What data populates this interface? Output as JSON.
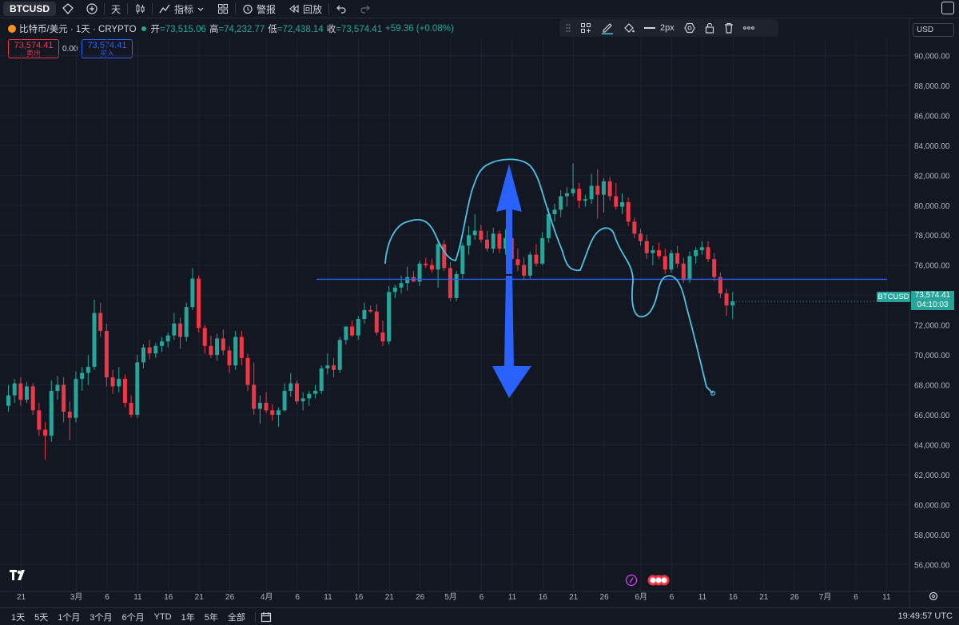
{
  "toolbar": {
    "symbol": "BTCUSD",
    "interval": "天",
    "indicators": "指标",
    "alerts": "警报",
    "replay": "回放"
  },
  "legend": {
    "title": "比特币/美元 · 1天 · CRYPTO",
    "open_label": "开",
    "open": "=73,515.06",
    "high_label": "高",
    "high": "=74,232.77",
    "low_label": "低",
    "low": "=72,438.14",
    "close_label": "收",
    "close": "=73,574.41",
    "change": "+59.36 (+0.08%)"
  },
  "trade": {
    "sell_price": "73,574.41",
    "sell_label": "卖出",
    "spread": "0.00",
    "buy_price": "73,574.41",
    "buy_label": "买入"
  },
  "drawing_toolbar": {
    "width_label": "2px"
  },
  "currency": "USD",
  "price_label": {
    "symbol": "BTCUSD",
    "price": "73,574.41",
    "countdown": "04:10:03"
  },
  "bottom": {
    "ranges": [
      "1天",
      "5天",
      "1个月",
      "3个月",
      "6个月",
      "YTD",
      "1年",
      "5年",
      "全部"
    ],
    "clock": "19:49:57 UTC"
  },
  "colors": {
    "up": "#26a69a",
    "down": "#f23645",
    "accent": "#2962ff",
    "pattern": "#4dc3e6",
    "background": "#131722"
  },
  "chart_data": {
    "type": "candlestick",
    "symbol": "BTCUSD",
    "ylim": [
      54200,
      91200
    ],
    "y_ticks": [
      56000,
      58000,
      60000,
      62000,
      64000,
      66000,
      68000,
      70000,
      72000,
      74000,
      76000,
      78000,
      80000,
      82000,
      84000,
      86000,
      88000,
      90000
    ],
    "y_tick_labels": [
      "56,000.00",
      "58,000.00",
      "60,000.00",
      "62,000.00",
      "64,000.00",
      "66,000.00",
      "68,000.00",
      "70,000.00",
      "72,000.00",
      "74,000.00",
      "76,000.00",
      "78,000.00",
      "80,000.00",
      "82,000.00",
      "84,000.00",
      "86,000.00",
      "88,000.00",
      "90,000.00"
    ],
    "x_tick_labels": [
      "21",
      "3月",
      "6",
      "11",
      "16",
      "21",
      "26",
      "4月",
      "6",
      "11",
      "16",
      "21",
      "26",
      "5月",
      "6",
      "11",
      "16",
      "21",
      "26",
      "6月",
      "6",
      "11",
      "16",
      "21",
      "26",
      "7月",
      "6",
      "11"
    ],
    "x_tick_day_index": [
      0,
      9,
      14,
      19,
      24,
      29,
      34,
      40,
      45,
      50,
      55,
      60,
      65,
      70,
      75,
      80,
      85,
      90,
      95,
      101,
      106,
      111,
      116,
      121,
      126,
      131,
      136,
      141
    ],
    "candles": [
      {
        "o": 66600,
        "h": 68000,
        "l": 66200,
        "c": 67300
      },
      {
        "o": 67300,
        "h": 68400,
        "l": 66800,
        "c": 68100
      },
      {
        "o": 68100,
        "h": 68500,
        "l": 66600,
        "c": 67000
      },
      {
        "o": 67000,
        "h": 68200,
        "l": 66800,
        "c": 67900
      },
      {
        "o": 67900,
        "h": 68100,
        "l": 66000,
        "c": 66300
      },
      {
        "o": 66300,
        "h": 66800,
        "l": 64600,
        "c": 65000
      },
      {
        "o": 65000,
        "h": 65500,
        "l": 63000,
        "c": 64600
      },
      {
        "o": 64600,
        "h": 68300,
        "l": 64200,
        "c": 67600
      },
      {
        "o": 67600,
        "h": 68600,
        "l": 67000,
        "c": 68000
      },
      {
        "o": 68000,
        "h": 68500,
        "l": 65500,
        "c": 66200
      },
      {
        "o": 66200,
        "h": 66900,
        "l": 64300,
        "c": 65800
      },
      {
        "o": 65800,
        "h": 68900,
        "l": 65500,
        "c": 68400
      },
      {
        "o": 68400,
        "h": 69200,
        "l": 67600,
        "c": 68800
      },
      {
        "o": 68800,
        "h": 70000,
        "l": 68000,
        "c": 69200
      },
      {
        "o": 69200,
        "h": 73700,
        "l": 69000,
        "c": 72800
      },
      {
        "o": 72800,
        "h": 73500,
        "l": 71200,
        "c": 71600
      },
      {
        "o": 71600,
        "h": 72100,
        "l": 67900,
        "c": 68500
      },
      {
        "o": 68500,
        "h": 69000,
        "l": 67400,
        "c": 67900
      },
      {
        "o": 67900,
        "h": 69200,
        "l": 67500,
        "c": 68400
      },
      {
        "o": 68400,
        "h": 68700,
        "l": 66500,
        "c": 66800
      },
      {
        "o": 66800,
        "h": 67300,
        "l": 65800,
        "c": 66000
      },
      {
        "o": 66000,
        "h": 70000,
        "l": 65800,
        "c": 69500
      },
      {
        "o": 69500,
        "h": 70700,
        "l": 69100,
        "c": 70500
      },
      {
        "o": 70500,
        "h": 71000,
        "l": 69700,
        "c": 70100
      },
      {
        "o": 70100,
        "h": 70800,
        "l": 69800,
        "c": 70600
      },
      {
        "o": 70600,
        "h": 71200,
        "l": 70200,
        "c": 70900
      },
      {
        "o": 70900,
        "h": 71500,
        "l": 70500,
        "c": 71300
      },
      {
        "o": 71300,
        "h": 72800,
        "l": 71000,
        "c": 72100
      },
      {
        "o": 72100,
        "h": 72500,
        "l": 70400,
        "c": 71200
      },
      {
        "o": 71200,
        "h": 73500,
        "l": 70900,
        "c": 73200
      },
      {
        "o": 73200,
        "h": 75800,
        "l": 73000,
        "c": 75100
      },
      {
        "o": 75100,
        "h": 75300,
        "l": 71500,
        "c": 71800
      },
      {
        "o": 71800,
        "h": 72000,
        "l": 70100,
        "c": 70600
      },
      {
        "o": 70600,
        "h": 71300,
        "l": 69800,
        "c": 70000
      },
      {
        "o": 70000,
        "h": 71400,
        "l": 69600,
        "c": 71100
      },
      {
        "o": 71100,
        "h": 71700,
        "l": 70000,
        "c": 70300
      },
      {
        "o": 70300,
        "h": 70600,
        "l": 68800,
        "c": 69300
      },
      {
        "o": 69300,
        "h": 71600,
        "l": 69000,
        "c": 71200
      },
      {
        "o": 71200,
        "h": 71600,
        "l": 69300,
        "c": 69800
      },
      {
        "o": 69800,
        "h": 70100,
        "l": 67600,
        "c": 68000
      },
      {
        "o": 68000,
        "h": 69500,
        "l": 66000,
        "c": 66400
      },
      {
        "o": 66400,
        "h": 67300,
        "l": 65400,
        "c": 66800
      },
      {
        "o": 66800,
        "h": 67500,
        "l": 66100,
        "c": 66300
      },
      {
        "o": 66300,
        "h": 66700,
        "l": 65600,
        "c": 66000
      },
      {
        "o": 66000,
        "h": 66500,
        "l": 65200,
        "c": 66300
      },
      {
        "o": 66300,
        "h": 68100,
        "l": 66200,
        "c": 67600
      },
      {
        "o": 67600,
        "h": 68800,
        "l": 67200,
        "c": 68100
      },
      {
        "o": 68100,
        "h": 68300,
        "l": 66700,
        "c": 66900
      },
      {
        "o": 66900,
        "h": 67500,
        "l": 66300,
        "c": 67100
      },
      {
        "o": 67100,
        "h": 67600,
        "l": 66600,
        "c": 67400
      },
      {
        "o": 67400,
        "h": 68000,
        "l": 67100,
        "c": 67600
      },
      {
        "o": 67600,
        "h": 69300,
        "l": 67400,
        "c": 69100
      },
      {
        "o": 69100,
        "h": 70100,
        "l": 68700,
        "c": 69300
      },
      {
        "o": 69300,
        "h": 69800,
        "l": 68500,
        "c": 69000
      },
      {
        "o": 69000,
        "h": 71200,
        "l": 68800,
        "c": 71000
      },
      {
        "o": 71000,
        "h": 71800,
        "l": 70700,
        "c": 71900
      },
      {
        "o": 71900,
        "h": 72300,
        "l": 71200,
        "c": 71300
      },
      {
        "o": 71300,
        "h": 72600,
        "l": 71000,
        "c": 72400
      },
      {
        "o": 72400,
        "h": 73500,
        "l": 72100,
        "c": 73000
      },
      {
        "o": 73000,
        "h": 73300,
        "l": 72800,
        "c": 72900
      },
      {
        "o": 72900,
        "h": 73400,
        "l": 71300,
        "c": 71500
      },
      {
        "o": 71500,
        "h": 72300,
        "l": 70600,
        "c": 70900
      },
      {
        "o": 70900,
        "h": 74600,
        "l": 70700,
        "c": 74200
      },
      {
        "o": 74200,
        "h": 74700,
        "l": 73800,
        "c": 74500
      },
      {
        "o": 74500,
        "h": 75300,
        "l": 74100,
        "c": 74800
      },
      {
        "o": 74800,
        "h": 75900,
        "l": 74300,
        "c": 75200
      },
      {
        "o": 75200,
        "h": 75600,
        "l": 74900,
        "c": 74900
      },
      {
        "o": 74900,
        "h": 76300,
        "l": 74600,
        "c": 76100
      },
      {
        "o": 76100,
        "h": 76500,
        "l": 75800,
        "c": 76000
      },
      {
        "o": 76000,
        "h": 76400,
        "l": 75500,
        "c": 75700
      },
      {
        "o": 75700,
        "h": 77600,
        "l": 74500,
        "c": 77400
      },
      {
        "o": 77400,
        "h": 77700,
        "l": 75600,
        "c": 75800
      },
      {
        "o": 75800,
        "h": 76200,
        "l": 73600,
        "c": 73800
      },
      {
        "o": 73800,
        "h": 75600,
        "l": 73600,
        "c": 75400
      },
      {
        "o": 75400,
        "h": 77500,
        "l": 75100,
        "c": 77300
      },
      {
        "o": 77300,
        "h": 78600,
        "l": 76700,
        "c": 78000
      },
      {
        "o": 78000,
        "h": 79400,
        "l": 77700,
        "c": 78300
      },
      {
        "o": 78300,
        "h": 78700,
        "l": 77500,
        "c": 77700
      },
      {
        "o": 77700,
        "h": 78300,
        "l": 76900,
        "c": 77100
      },
      {
        "o": 77100,
        "h": 78500,
        "l": 76800,
        "c": 78100
      },
      {
        "o": 78100,
        "h": 78300,
        "l": 76800,
        "c": 77100
      },
      {
        "o": 77100,
        "h": 78400,
        "l": 76700,
        "c": 77800
      },
      {
        "o": 77800,
        "h": 78700,
        "l": 76100,
        "c": 76400
      },
      {
        "o": 76400,
        "h": 77100,
        "l": 75600,
        "c": 76000
      },
      {
        "o": 76000,
        "h": 76500,
        "l": 75000,
        "c": 75300
      },
      {
        "o": 75300,
        "h": 76900,
        "l": 75100,
        "c": 76700
      },
      {
        "o": 76700,
        "h": 77400,
        "l": 75900,
        "c": 76100
      },
      {
        "o": 76100,
        "h": 78200,
        "l": 76000,
        "c": 77800
      },
      {
        "o": 77800,
        "h": 79800,
        "l": 77500,
        "c": 79400
      },
      {
        "o": 79400,
        "h": 80100,
        "l": 78900,
        "c": 79700
      },
      {
        "o": 79700,
        "h": 81000,
        "l": 79200,
        "c": 80600
      },
      {
        "o": 80600,
        "h": 81200,
        "l": 79900,
        "c": 80800
      },
      {
        "o": 80800,
        "h": 82800,
        "l": 80600,
        "c": 81100
      },
      {
        "o": 81100,
        "h": 81500,
        "l": 79800,
        "c": 80300
      },
      {
        "o": 80300,
        "h": 80700,
        "l": 79900,
        "c": 80400
      },
      {
        "o": 80400,
        "h": 82100,
        "l": 80100,
        "c": 81300
      },
      {
        "o": 81300,
        "h": 82400,
        "l": 79100,
        "c": 80700
      },
      {
        "o": 80700,
        "h": 81800,
        "l": 79500,
        "c": 81600
      },
      {
        "o": 81600,
        "h": 81900,
        "l": 80300,
        "c": 80600
      },
      {
        "o": 80600,
        "h": 81500,
        "l": 79700,
        "c": 79900
      },
      {
        "o": 79900,
        "h": 80800,
        "l": 79400,
        "c": 80200
      },
      {
        "o": 80200,
        "h": 80500,
        "l": 78600,
        "c": 78900
      },
      {
        "o": 78900,
        "h": 79200,
        "l": 77800,
        "c": 78100
      },
      {
        "o": 78100,
        "h": 78400,
        "l": 77300,
        "c": 77600
      },
      {
        "o": 77600,
        "h": 78000,
        "l": 76400,
        "c": 76800
      },
      {
        "o": 76800,
        "h": 77300,
        "l": 76000,
        "c": 77000
      },
      {
        "o": 77000,
        "h": 77500,
        "l": 76400,
        "c": 76600
      },
      {
        "o": 76600,
        "h": 77100,
        "l": 75400,
        "c": 75700
      },
      {
        "o": 75700,
        "h": 77000,
        "l": 75500,
        "c": 76800
      },
      {
        "o": 76800,
        "h": 77300,
        "l": 75800,
        "c": 76100
      },
      {
        "o": 76100,
        "h": 76500,
        "l": 74800,
        "c": 75000
      },
      {
        "o": 75000,
        "h": 76900,
        "l": 74800,
        "c": 76600
      },
      {
        "o": 76600,
        "h": 77200,
        "l": 76100,
        "c": 77000
      },
      {
        "o": 77000,
        "h": 77600,
        "l": 76700,
        "c": 77200
      },
      {
        "o": 77200,
        "h": 77600,
        "l": 76200,
        "c": 76400
      },
      {
        "o": 76400,
        "h": 76800,
        "l": 74900,
        "c": 75200
      },
      {
        "o": 75200,
        "h": 75500,
        "l": 73800,
        "c": 74100
      },
      {
        "o": 74100,
        "h": 74400,
        "l": 72600,
        "c": 73300
      },
      {
        "o": 73300,
        "h": 74200,
        "l": 72400,
        "c": 73574.41
      }
    ],
    "horizontal_line": 75050
  }
}
